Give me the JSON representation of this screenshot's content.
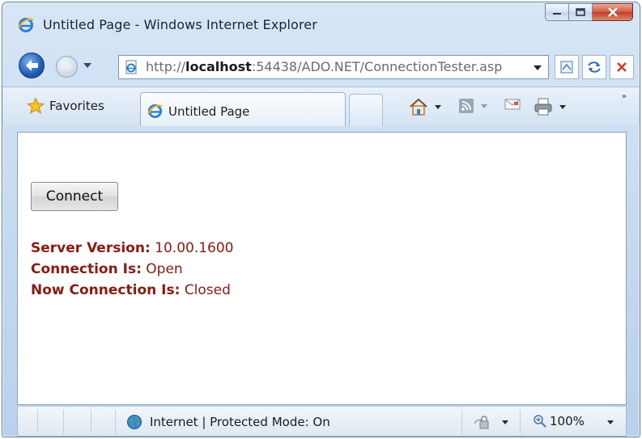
{
  "window": {
    "title": "Untitled Page - Windows Internet Explorer"
  },
  "address": {
    "url_prefix": "http://",
    "url_host": "localhost",
    "url_rest": ":54438/ADO.NET/ConnectionTester.aspx"
  },
  "toolbar": {
    "favorites_label": "Favorites",
    "tab_title": "Untitled Page",
    "chevrons": "»"
  },
  "page": {
    "connect_button": "Connect",
    "server_version_label": "Server Version:",
    "server_version_value": "10.00.1600",
    "connection_label": "Connection Is:",
    "connection_value": "Open",
    "now_connection_label": "Now Connection Is:",
    "now_connection_value": "Closed"
  },
  "statusbar": {
    "zone": "Internet | Protected Mode: On",
    "zoom": "100%"
  },
  "icons": {
    "browser": "ie-logo-icon",
    "back": "back-arrow-icon",
    "forward": "forward-arrow-icon",
    "compat": "compatibility-view-icon",
    "refresh": "refresh-icon",
    "stop": "stop-icon",
    "home": "home-icon",
    "feeds": "rss-feed-icon",
    "mail": "mail-icon",
    "print": "print-icon",
    "globe": "globe-icon",
    "lock": "lock-icon",
    "zoom": "magnifier-icon"
  },
  "colors": {
    "result_text": "#8b1a10",
    "close_button": "#c33b1f"
  }
}
